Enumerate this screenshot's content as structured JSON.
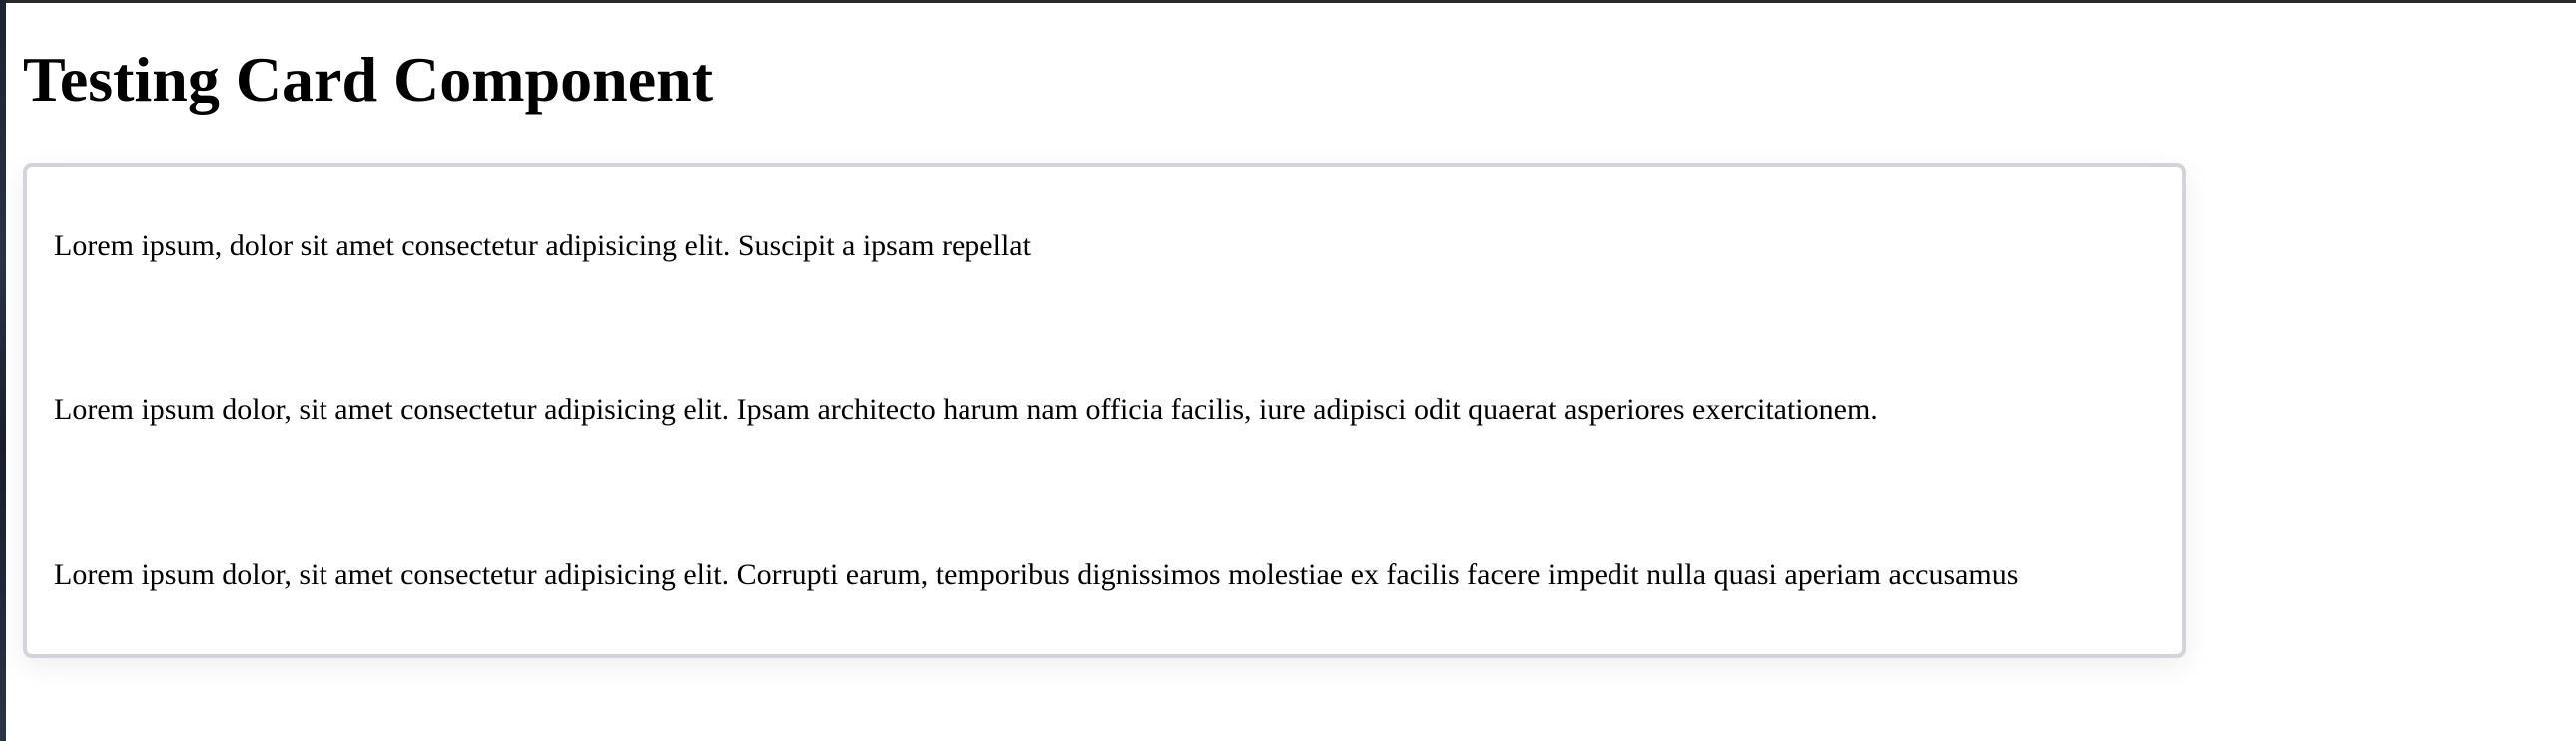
{
  "page": {
    "title": "Testing Card Component"
  },
  "card": {
    "paragraphs": [
      "Lorem ipsum, dolor sit amet consectetur adipisicing elit. Suscipit a ipsam repellat",
      "Lorem ipsum dolor, sit amet consectetur adipisicing elit. Ipsam architecto harum nam officia facilis, iure adipisci odit quaerat asperiores exercitationem.",
      "Lorem ipsum dolor, sit amet consectetur adipisicing elit. Corrupti earum, temporibus dignissimos molestiae ex facilis facere impedit nulla quasi aperiam accusamus"
    ]
  },
  "colors": {
    "card_border": "#d3d4da",
    "background": "#ffffff",
    "text": "#000000"
  }
}
